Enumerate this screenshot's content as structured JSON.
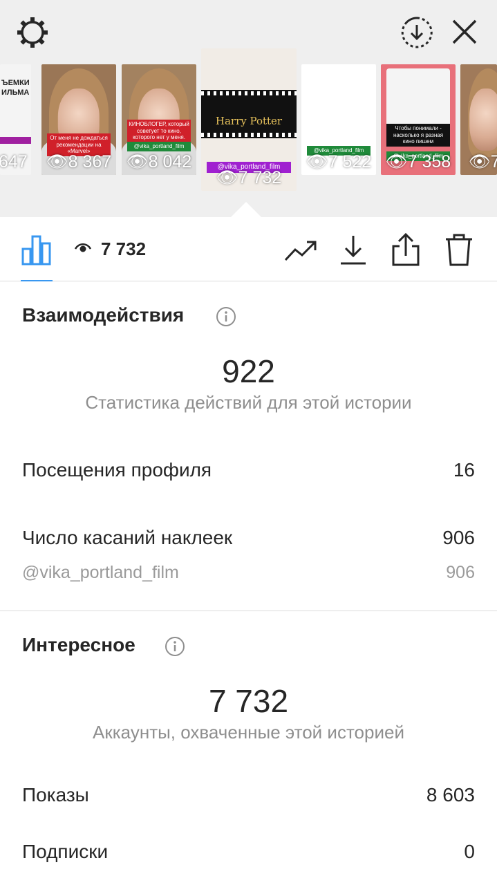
{
  "header": {
    "settings_icon": "gear-icon",
    "download_all_icon": "download-circle-icon",
    "close_icon": "close-icon"
  },
  "thumbnails": [
    {
      "views": "647",
      "text": "ЪЕМКИ ИЛЬМА"
    },
    {
      "views": "8 367",
      "text": "От меня не дождаться рекомендации на «Marvel»"
    },
    {
      "views": "8 042",
      "text": "КИНОБЛОГЕР, который советует то кино, которого нет у меня.",
      "tag": "@vika_portland_film"
    },
    {
      "views": "7 732",
      "text": "Harry Potter",
      "tag": "@vika_portland_film"
    },
    {
      "views": "7 522",
      "tag": "@vika_portland_film"
    },
    {
      "views": "7 358",
      "text": "Чтобы понимали - насколько я разная кино пишем",
      "tag": "@vika_portland_film"
    },
    {
      "views": "7"
    }
  ],
  "toolbar": {
    "insights_icon": "bar-chart-icon",
    "eye_icon": "eye-icon",
    "views": "7 732",
    "promote_icon": "trend-up-icon",
    "save_icon": "download-icon",
    "share_icon": "share-icon",
    "delete_icon": "trash-icon"
  },
  "interactions": {
    "title": "Взаимодействия",
    "total": "922",
    "caption": "Статистика действий для этой истории",
    "rows": [
      {
        "label": "Посещения профиля",
        "value": "16"
      },
      {
        "label": "Число касаний наклеек",
        "value": "906"
      }
    ],
    "sub": {
      "label": "@vika_portland_film",
      "value": "906"
    }
  },
  "discovery": {
    "title": "Интересное",
    "total": "7 732",
    "caption": "Аккаунты, охваченные этой историей",
    "rows": [
      {
        "label": "Показы",
        "value": "8 603"
      },
      {
        "label": "Подписки",
        "value": "0"
      }
    ]
  },
  "colors": {
    "accent": "#3897f0",
    "header_bg": "#efefef",
    "text": "#262626",
    "muted": "#8e8e8e"
  }
}
